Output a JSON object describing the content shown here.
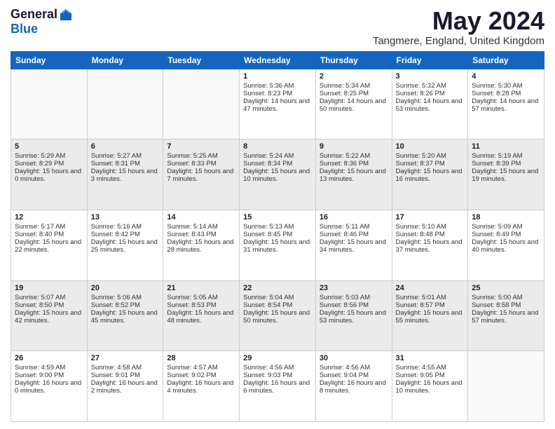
{
  "logo": {
    "general": "General",
    "blue": "Blue"
  },
  "title": {
    "month_year": "May 2024",
    "location": "Tangmere, England, United Kingdom"
  },
  "days_header": [
    "Sunday",
    "Monday",
    "Tuesday",
    "Wednesday",
    "Thursday",
    "Friday",
    "Saturday"
  ],
  "weeks": [
    [
      {
        "day": "",
        "sunrise": "",
        "sunset": "",
        "daylight": ""
      },
      {
        "day": "",
        "sunrise": "",
        "sunset": "",
        "daylight": ""
      },
      {
        "day": "",
        "sunrise": "",
        "sunset": "",
        "daylight": ""
      },
      {
        "day": "1",
        "sunrise": "Sunrise: 5:36 AM",
        "sunset": "Sunset: 8:23 PM",
        "daylight": "Daylight: 14 hours and 47 minutes."
      },
      {
        "day": "2",
        "sunrise": "Sunrise: 5:34 AM",
        "sunset": "Sunset: 8:25 PM",
        "daylight": "Daylight: 14 hours and 50 minutes."
      },
      {
        "day": "3",
        "sunrise": "Sunrise: 5:32 AM",
        "sunset": "Sunset: 8:26 PM",
        "daylight": "Daylight: 14 hours and 53 minutes."
      },
      {
        "day": "4",
        "sunrise": "Sunrise: 5:30 AM",
        "sunset": "Sunset: 8:28 PM",
        "daylight": "Daylight: 14 hours and 57 minutes."
      }
    ],
    [
      {
        "day": "5",
        "sunrise": "Sunrise: 5:29 AM",
        "sunset": "Sunset: 8:29 PM",
        "daylight": "Daylight: 15 hours and 0 minutes."
      },
      {
        "day": "6",
        "sunrise": "Sunrise: 5:27 AM",
        "sunset": "Sunset: 8:31 PM",
        "daylight": "Daylight: 15 hours and 3 minutes."
      },
      {
        "day": "7",
        "sunrise": "Sunrise: 5:25 AM",
        "sunset": "Sunset: 8:33 PM",
        "daylight": "Daylight: 15 hours and 7 minutes."
      },
      {
        "day": "8",
        "sunrise": "Sunrise: 5:24 AM",
        "sunset": "Sunset: 8:34 PM",
        "daylight": "Daylight: 15 hours and 10 minutes."
      },
      {
        "day": "9",
        "sunrise": "Sunrise: 5:22 AM",
        "sunset": "Sunset: 8:36 PM",
        "daylight": "Daylight: 15 hours and 13 minutes."
      },
      {
        "day": "10",
        "sunrise": "Sunrise: 5:20 AM",
        "sunset": "Sunset: 8:37 PM",
        "daylight": "Daylight: 15 hours and 16 minutes."
      },
      {
        "day": "11",
        "sunrise": "Sunrise: 5:19 AM",
        "sunset": "Sunset: 8:39 PM",
        "daylight": "Daylight: 15 hours and 19 minutes."
      }
    ],
    [
      {
        "day": "12",
        "sunrise": "Sunrise: 5:17 AM",
        "sunset": "Sunset: 8:40 PM",
        "daylight": "Daylight: 15 hours and 22 minutes."
      },
      {
        "day": "13",
        "sunrise": "Sunrise: 5:16 AM",
        "sunset": "Sunset: 8:42 PM",
        "daylight": "Daylight: 15 hours and 25 minutes."
      },
      {
        "day": "14",
        "sunrise": "Sunrise: 5:14 AM",
        "sunset": "Sunset: 8:43 PM",
        "daylight": "Daylight: 15 hours and 28 minutes."
      },
      {
        "day": "15",
        "sunrise": "Sunrise: 5:13 AM",
        "sunset": "Sunset: 8:45 PM",
        "daylight": "Daylight: 15 hours and 31 minutes."
      },
      {
        "day": "16",
        "sunrise": "Sunrise: 5:11 AM",
        "sunset": "Sunset: 8:46 PM",
        "daylight": "Daylight: 15 hours and 34 minutes."
      },
      {
        "day": "17",
        "sunrise": "Sunrise: 5:10 AM",
        "sunset": "Sunset: 8:48 PM",
        "daylight": "Daylight: 15 hours and 37 minutes."
      },
      {
        "day": "18",
        "sunrise": "Sunrise: 5:09 AM",
        "sunset": "Sunset: 8:49 PM",
        "daylight": "Daylight: 15 hours and 40 minutes."
      }
    ],
    [
      {
        "day": "19",
        "sunrise": "Sunrise: 5:07 AM",
        "sunset": "Sunset: 8:50 PM",
        "daylight": "Daylight: 15 hours and 42 minutes."
      },
      {
        "day": "20",
        "sunrise": "Sunrise: 5:06 AM",
        "sunset": "Sunset: 8:52 PM",
        "daylight": "Daylight: 15 hours and 45 minutes."
      },
      {
        "day": "21",
        "sunrise": "Sunrise: 5:05 AM",
        "sunset": "Sunset: 8:53 PM",
        "daylight": "Daylight: 15 hours and 48 minutes."
      },
      {
        "day": "22",
        "sunrise": "Sunrise: 5:04 AM",
        "sunset": "Sunset: 8:54 PM",
        "daylight": "Daylight: 15 hours and 50 minutes."
      },
      {
        "day": "23",
        "sunrise": "Sunrise: 5:03 AM",
        "sunset": "Sunset: 8:56 PM",
        "daylight": "Daylight: 15 hours and 53 minutes."
      },
      {
        "day": "24",
        "sunrise": "Sunrise: 5:01 AM",
        "sunset": "Sunset: 8:57 PM",
        "daylight": "Daylight: 15 hours and 55 minutes."
      },
      {
        "day": "25",
        "sunrise": "Sunrise: 5:00 AM",
        "sunset": "Sunset: 8:58 PM",
        "daylight": "Daylight: 15 hours and 57 minutes."
      }
    ],
    [
      {
        "day": "26",
        "sunrise": "Sunrise: 4:59 AM",
        "sunset": "Sunset: 9:00 PM",
        "daylight": "Daylight: 16 hours and 0 minutes."
      },
      {
        "day": "27",
        "sunrise": "Sunrise: 4:58 AM",
        "sunset": "Sunset: 9:01 PM",
        "daylight": "Daylight: 16 hours and 2 minutes."
      },
      {
        "day": "28",
        "sunrise": "Sunrise: 4:57 AM",
        "sunset": "Sunset: 9:02 PM",
        "daylight": "Daylight: 16 hours and 4 minutes."
      },
      {
        "day": "29",
        "sunrise": "Sunrise: 4:56 AM",
        "sunset": "Sunset: 9:03 PM",
        "daylight": "Daylight: 16 hours and 6 minutes."
      },
      {
        "day": "30",
        "sunrise": "Sunrise: 4:56 AM",
        "sunset": "Sunset: 9:04 PM",
        "daylight": "Daylight: 16 hours and 8 minutes."
      },
      {
        "day": "31",
        "sunrise": "Sunrise: 4:55 AM",
        "sunset": "Sunset: 9:05 PM",
        "daylight": "Daylight: 16 hours and 10 minutes."
      },
      {
        "day": "",
        "sunrise": "",
        "sunset": "",
        "daylight": ""
      }
    ]
  ]
}
